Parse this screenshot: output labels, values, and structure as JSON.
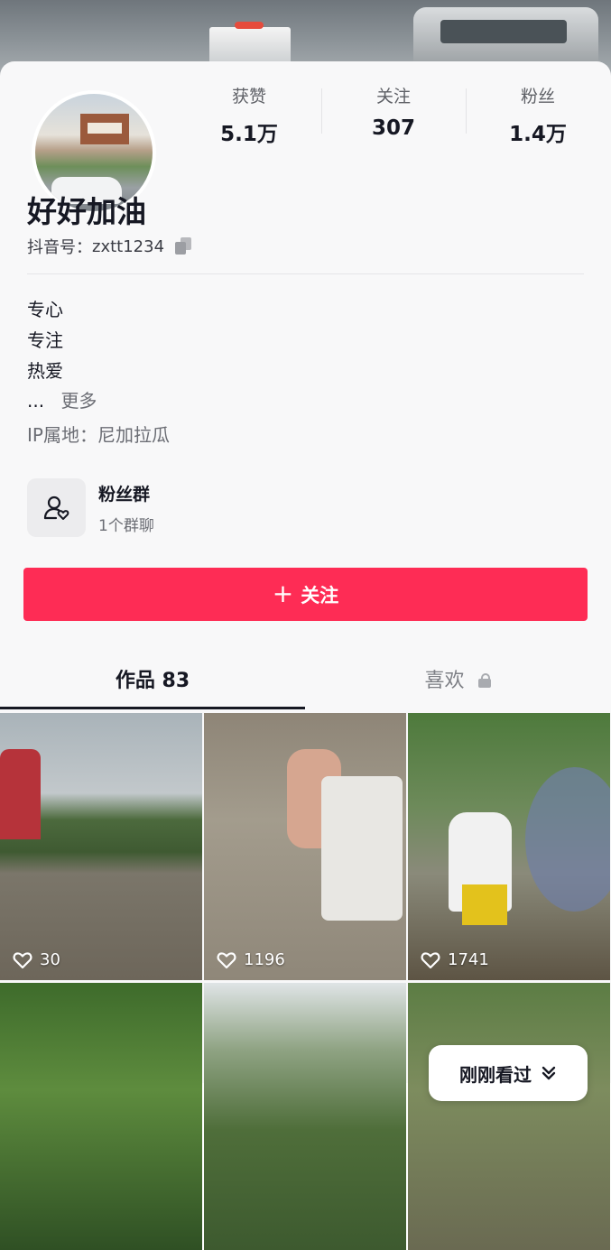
{
  "stats": [
    {
      "label": "获赞",
      "value": "5.1万"
    },
    {
      "label": "关注",
      "value": "307"
    },
    {
      "label": "粉丝",
      "value": "1.4万"
    }
  ],
  "profile": {
    "name": "好好加油",
    "id_label": "抖音号：",
    "id_value": "zxtt1234",
    "bio_lines": [
      "专心",
      "专注",
      "热爱"
    ],
    "bio_ellipsis": "...",
    "bio_more": "更多",
    "ip_location": "IP属地：尼加拉瓜"
  },
  "fans_group": {
    "title": "粉丝群",
    "subtitle": "1个群聊"
  },
  "follow_button": {
    "plus": "+",
    "label": "关注"
  },
  "tabs": {
    "works": "作品 83",
    "likes": "喜欢"
  },
  "videos": [
    {
      "likes": "30"
    },
    {
      "likes": "1196"
    },
    {
      "likes": "1741"
    }
  ],
  "recent_button": {
    "label": "刚刚看过"
  },
  "colors": {
    "follow_button": "#fe2c55",
    "primary_text": "#161823",
    "secondary_text": "#6b6d74"
  }
}
